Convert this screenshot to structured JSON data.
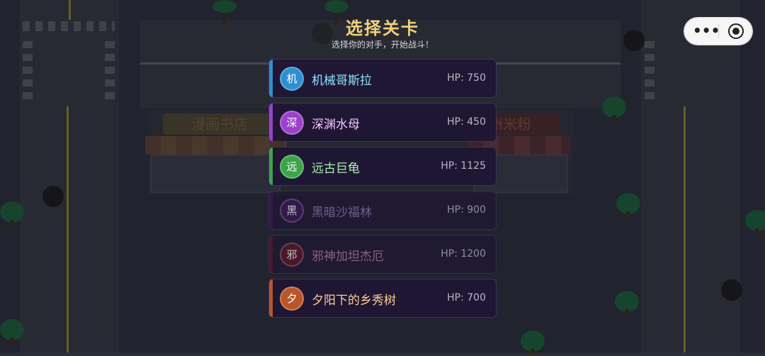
{
  "header": {
    "title": "选择关卡",
    "subtitle": "选择你的对手，开始战斗！"
  },
  "background": {
    "signs": [
      "漫画书店",
      "州米粉"
    ]
  },
  "levels": [
    {
      "icon_char": "机",
      "name": "机械哥斯拉",
      "hp": "HP: 750",
      "color": "#2f8fd0",
      "name_color": "#8fe3ff",
      "locked": false
    },
    {
      "icon_char": "深",
      "name": "深渊水母",
      "hp": "HP: 450",
      "color": "#9a42c8",
      "name_color": "#f2c3ff",
      "locked": false
    },
    {
      "icon_char": "远",
      "name": "远古巨龟",
      "hp": "HP: 1125",
      "color": "#3da34a",
      "name_color": "#a9f0ae",
      "locked": false
    },
    {
      "icon_char": "黑",
      "name": "黑暗沙福林",
      "hp": "HP: 900",
      "color": "#3b1656",
      "name_color": "#8d74b0",
      "locked": true
    },
    {
      "icon_char": "邪",
      "name": "邪神加坦杰厄",
      "hp": "HP: 1200",
      "color": "#5a1428",
      "name_color": "#b07a98",
      "locked": true
    },
    {
      "icon_char": "夕",
      "name": "夕阳下的乡秀树",
      "hp": "HP: 700",
      "color": "#b8562a",
      "name_color": "#ffcf96",
      "locked": false
    }
  ],
  "capsule": {
    "menu_icon": "more-dots-icon",
    "close_icon": "target-close-icon"
  }
}
